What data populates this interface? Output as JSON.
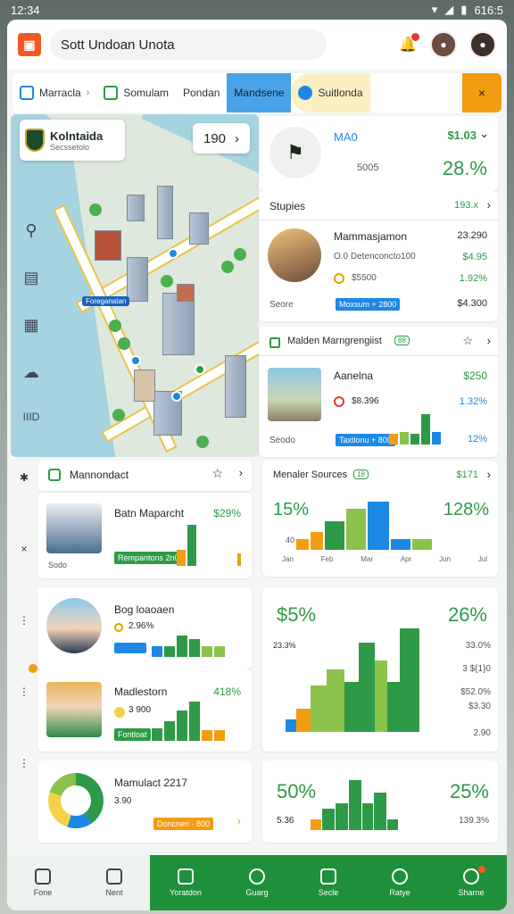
{
  "status": {
    "time": "12:34",
    "right": "616:5"
  },
  "topbar": {
    "search_text": "Sott Undoan Unota"
  },
  "crumbs": [
    {
      "label": "Marracla"
    },
    {
      "label": "Somulam"
    },
    {
      "label": "Pondan"
    },
    {
      "label": "Mandsene"
    },
    {
      "label": "Suitlonda"
    },
    {
      "label": "×"
    }
  ],
  "map": {
    "title": "Kolntaida",
    "subtitle": "Secssetolo",
    "zoom": "190",
    "label": "Foreganatan"
  },
  "cards": {
    "c1": {
      "title": "MA0",
      "value": "$1.03",
      "sub": "5005",
      "pct": "28.%"
    },
    "c2": {
      "header": "Stupies",
      "header_val": "193.x",
      "name": "Mammasjamon",
      "val": "23.290",
      "line2": "O.0 Detenconcto100",
      "line2_val": "$4.95",
      "line3": "$5500",
      "line3_val": "1.92%",
      "tag": "Moxsum + 2800",
      "left_label": "Seore",
      "right_val": "$4.300"
    },
    "c3": {
      "header": "Malden Marngrengiist",
      "chip": "88",
      "name": "Aanelna",
      "val": "$250",
      "line2": "$8.396",
      "line2_val": "1.32%",
      "tag": "Taxtlonu + 800",
      "left_label": "Seodo",
      "right_val": "12%"
    },
    "c4": {
      "header": "Mannondact",
      "item1": {
        "name": "Batn Maparcht",
        "pct": "$29%",
        "tag": "Rempantons 2n0",
        "foot": "Sodo"
      },
      "item2": {
        "name": "Bog loaoaen",
        "val": "2.96%"
      },
      "item3": {
        "name": "Madlestorn",
        "pct": "418%",
        "val": "3 900",
        "tag": "Fontloat"
      },
      "item4": {
        "name": "Mamulact 2217",
        "val": "3.90",
        "tag": "Doncnen · 800"
      }
    },
    "c5": {
      "header": "Menaler Sources",
      "chip": "18",
      "header_val": "$171",
      "left_pct": "15%",
      "right_pct": "128%",
      "xlabels": [
        "Jan",
        "Feb",
        "Mar",
        "Apr",
        "Jun",
        "Jul"
      ],
      "val_left": "40"
    },
    "c6": {
      "left_pct": "$5%",
      "right_pct": "26%",
      "vals": [
        "23.3%",
        "33.0%",
        "3 ${1}0",
        "$52.0%",
        "$3.30",
        "2.90"
      ]
    },
    "c7": {
      "left_pct": "50%",
      "right_pct": "25%",
      "left_val": "5.36",
      "right_val": "139.3%"
    }
  },
  "nav": [
    "Fone",
    "Nent",
    "Yoratdon",
    "Guarg",
    "Secle",
    "Ratye",
    "Sharne"
  ],
  "colors": {
    "green": "#2e9a47",
    "blue": "#1e88e5",
    "orange": "#f39c12",
    "accent": "#f15a24"
  }
}
